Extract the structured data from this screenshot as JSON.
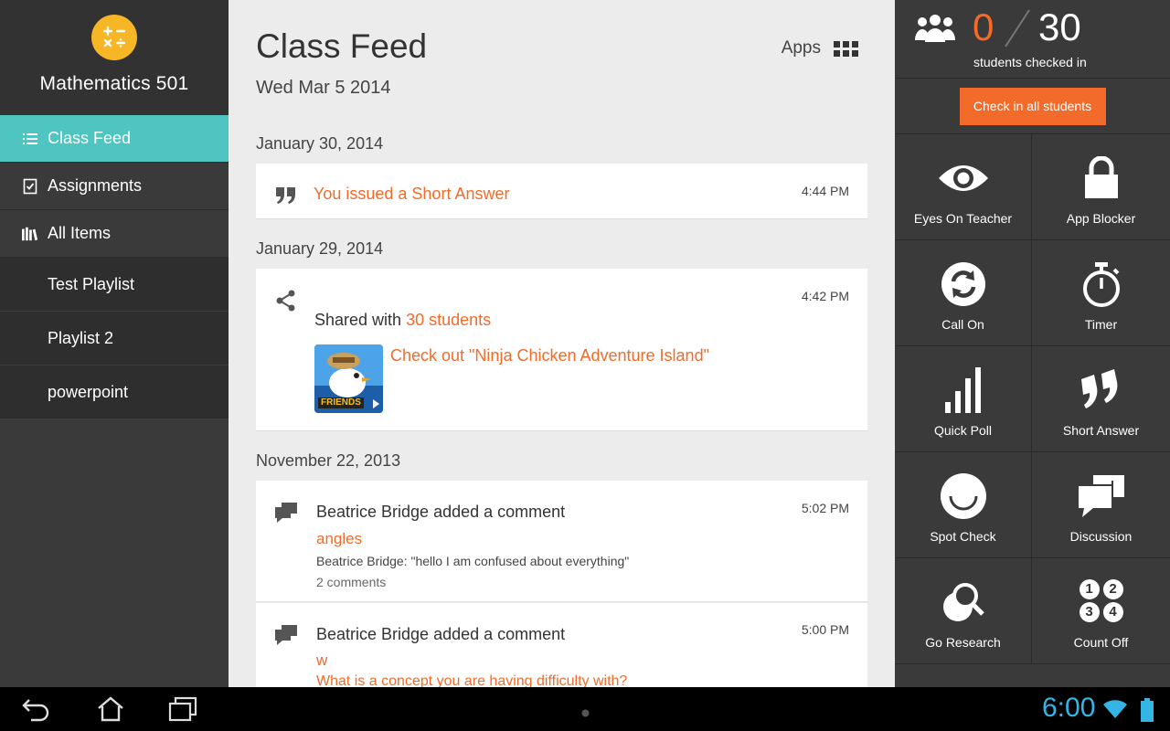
{
  "sidebar": {
    "class_name": "Mathematics 501",
    "logo_icon": "calculator-icon",
    "nav_items": [
      {
        "label": "Class Feed",
        "icon": "list-icon",
        "active": true
      },
      {
        "label": "Assignments",
        "icon": "checklist-icon",
        "active": false
      },
      {
        "label": "All Items",
        "icon": "library-icon",
        "active": false
      }
    ],
    "playlists": [
      "Test Playlist",
      "Playlist 2",
      "powerpoint"
    ]
  },
  "feed": {
    "title": "Class Feed",
    "date": "Wed Mar 5 2014",
    "apps_label": "Apps",
    "groups": [
      {
        "date": "January 30, 2014",
        "items": [
          {
            "icon": "quote-icon",
            "time": "4:44 PM",
            "title": "You issued a Short Answer"
          }
        ]
      },
      {
        "date": "January 29, 2014",
        "items": [
          {
            "icon": "share-icon",
            "time": "4:42 PM",
            "shared_prefix": "Shared with",
            "shared_target": "30 students",
            "link": "Check out \"Ninja Chicken Adventure Island\"",
            "thumbnail_text": "FRIENDS"
          }
        ]
      },
      {
        "date": "November 22, 2013",
        "items": [
          {
            "icon": "comments-icon",
            "time": "5:02 PM",
            "title": "Beatrice Bridge added a comment",
            "topic": "angles",
            "comment": "Beatrice Bridge: \"hello I am confused about everything\"",
            "count": "2 comments"
          },
          {
            "icon": "comments-icon",
            "time": "5:00 PM",
            "title": "Beatrice Bridge added a comment",
            "topic": "w",
            "comment": "What is a concept you are having difficulty with?"
          }
        ]
      }
    ]
  },
  "checkin": {
    "checked": "0",
    "total": "30",
    "label": "students checked in",
    "button": "Check in all students"
  },
  "tools": [
    {
      "label": "Eyes On Teacher",
      "icon": "eye-icon"
    },
    {
      "label": "App Blocker",
      "icon": "lock-icon"
    },
    {
      "label": "Call On",
      "icon": "refresh-icon"
    },
    {
      "label": "Timer",
      "icon": "stopwatch-icon"
    },
    {
      "label": "Quick Poll",
      "icon": "bar-chart-icon"
    },
    {
      "label": "Short Answer",
      "icon": "quote-icon"
    },
    {
      "label": "Spot Check",
      "icon": "smile-icon"
    },
    {
      "label": "Discussion",
      "icon": "chat-bubbles-icon"
    },
    {
      "label": "Go Research",
      "icon": "magnifier-icon"
    },
    {
      "label": "Count Off",
      "icon": "numbers-icon"
    }
  ],
  "count_off_numbers": [
    "1",
    "2",
    "3",
    "4"
  ],
  "system": {
    "clock": "6:00"
  },
  "colors": {
    "accent_orange": "#f26b2a",
    "active_teal": "#4ec5c1",
    "logo_yellow": "#f7b626",
    "clock_blue": "#33b5e5"
  }
}
